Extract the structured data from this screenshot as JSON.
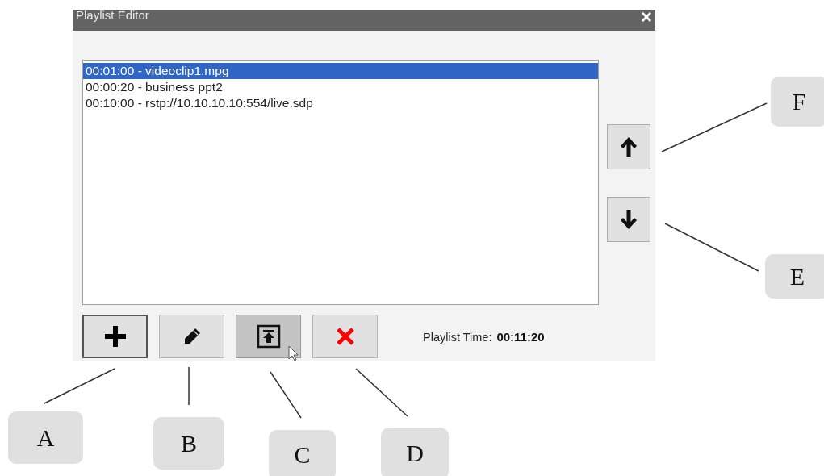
{
  "window": {
    "title": "Playlist Editor",
    "close": "×"
  },
  "playlist": [
    {
      "text": "00:01:00 - videoclip1.mpg",
      "selected": true
    },
    {
      "text": "00:00:20 - business ppt2",
      "selected": false
    },
    {
      "text": "00:10:00 - rstp://10.10.10.10:554/live.sdp",
      "selected": false
    }
  ],
  "move_buttons": [
    {
      "kind": "up"
    },
    {
      "kind": "down"
    }
  ],
  "toolbar": [
    {
      "kind": "add",
      "focused": true,
      "hovered": false
    },
    {
      "kind": "edit",
      "focused": false,
      "hovered": false
    },
    {
      "kind": "upload",
      "focused": false,
      "hovered": true
    },
    {
      "kind": "delete",
      "focused": false,
      "hovered": false
    }
  ],
  "playlist_time": {
    "label": "Playlist Time:",
    "value": "00:11:20"
  },
  "callouts": [
    {
      "label": "A"
    },
    {
      "label": "B"
    },
    {
      "label": "C"
    },
    {
      "label": "D"
    },
    {
      "label": "E"
    },
    {
      "label": "F"
    }
  ]
}
